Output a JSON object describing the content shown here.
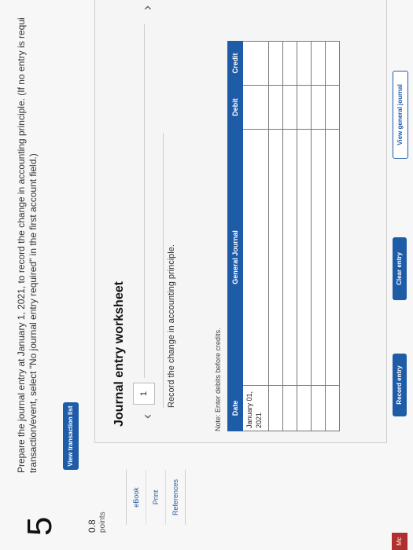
{
  "question": {
    "number": "5",
    "points_value": "0.8",
    "points_label": "points",
    "prompt_line1": "Prepare the journal entry at January 1, 2021, to record the change in accounting principle. (If no entry is requi",
    "prompt_line2": "transaction/event, select \"No journal entry required\" in the first account field.)"
  },
  "side_links": [
    "eBook",
    "Print",
    "References"
  ],
  "buttons": {
    "view_transaction_list": "View transaction list",
    "record_entry": "Record entry",
    "clear_entry": "Clear entry",
    "view_general_journal": "View general journal"
  },
  "worksheet": {
    "title": "Journal entry worksheet",
    "current_entry": "1",
    "instruction": "Record the change in accounting principle.",
    "note": "Note: Enter debits before credits."
  },
  "journal": {
    "headers": [
      "Date",
      "General Journal",
      "Debit",
      "Credit"
    ],
    "first_date_line1": "January 01,",
    "first_date_line2": "2021"
  },
  "badge": "Mc"
}
